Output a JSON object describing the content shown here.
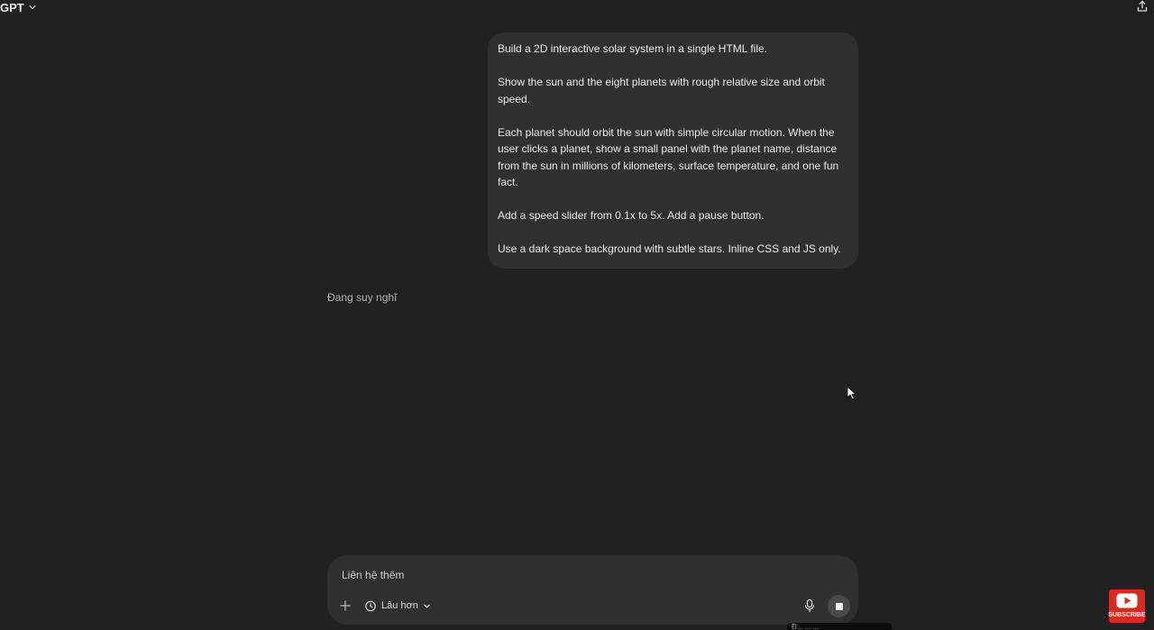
{
  "header": {
    "title": "GPT",
    "model_chevron_icon": "chevron-down-icon",
    "share_icon": "share-upload-icon"
  },
  "conversation": {
    "user_message": {
      "paragraphs": [
        "Build a 2D interactive solar system in a single HTML file.",
        "Show the sun and the eight planets with rough relative size and orbit speed.",
        "Each planet should orbit the sun with simple circular motion. When the user clicks a planet, show a small panel with the planet name, distance from the sun in millions of kilometers, surface temperature, and one fun fact.",
        "Add a speed slider from 0.1x to 5x. Add a pause button.",
        "Use a dark space background with subtle stars. Inline CSS and JS only."
      ]
    },
    "assistant_status": "Đang suy nghĩ"
  },
  "composer": {
    "placeholder": "Liên hệ thêm",
    "add_icon": "plus-icon",
    "mode_label": "Lâu hơn",
    "mode_icon": "timer-icon",
    "mic_icon": "microphone-icon",
    "stop_icon": "stop-icon"
  },
  "overlay": {
    "tooltip_text": "Đ... ... ...",
    "subscribe_label": "SUBSCRIBE"
  },
  "colors": {
    "background": "#212121",
    "bubble": "#303030",
    "composer": "#303030",
    "subscribe_red": "#d52b23"
  }
}
